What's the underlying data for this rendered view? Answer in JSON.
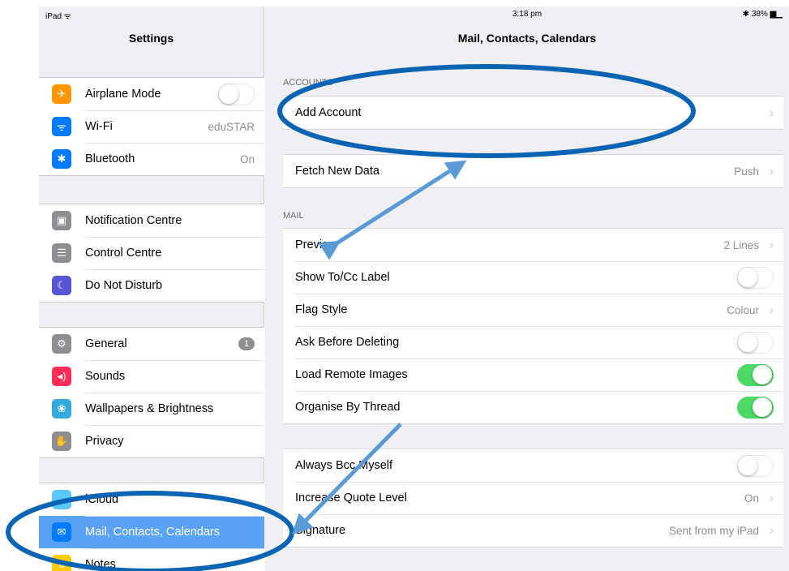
{
  "status": {
    "device": "iPad ᯤ",
    "time": "3:18 pm",
    "battery": "✱ 38% ▆▁"
  },
  "sidebar": {
    "title": "Settings",
    "groups": [
      [
        {
          "label": "Airplane Mode",
          "icon": "airplane-icon",
          "color": "#ff9500",
          "glyph": "✈",
          "toggle": false
        },
        {
          "label": "Wi-Fi",
          "icon": "wifi-icon",
          "color": "#007aff",
          "glyph": "ᯤ",
          "value": "eduSTAR"
        },
        {
          "label": "Bluetooth",
          "icon": "bluetooth-icon",
          "color": "#007aff",
          "glyph": "✱",
          "value": "On"
        }
      ],
      [
        {
          "label": "Notification Centre",
          "icon": "notification-centre-icon",
          "color": "#8e8e93",
          "glyph": "▣"
        },
        {
          "label": "Control Centre",
          "icon": "control-centre-icon",
          "color": "#8e8e93",
          "glyph": "☰"
        },
        {
          "label": "Do Not Disturb",
          "icon": "moon-icon",
          "color": "#5856d6",
          "glyph": "☾"
        }
      ],
      [
        {
          "label": "General",
          "icon": "gear-icon",
          "color": "#8e8e93",
          "glyph": "⚙",
          "badge": "1"
        },
        {
          "label": "Sounds",
          "icon": "speaker-icon",
          "color": "#ff2d55",
          "glyph": "◂)"
        },
        {
          "label": "Wallpapers & Brightness",
          "icon": "wallpaper-icon",
          "color": "#34aadc",
          "glyph": "❀"
        },
        {
          "label": "Privacy",
          "icon": "hand-icon",
          "color": "#8e8e93",
          "glyph": "✋"
        }
      ],
      [
        {
          "label": "iCloud",
          "icon": "cloud-icon",
          "color": "#5ac8fa",
          "glyph": "☁"
        },
        {
          "label": "Mail, Contacts, Calendars",
          "icon": "mail-icon",
          "color": "#007aff",
          "glyph": "✉",
          "selected": true
        },
        {
          "label": "Notes",
          "icon": "notes-icon",
          "color": "#ffcc00",
          "glyph": "≡"
        }
      ]
    ]
  },
  "main": {
    "title": "Mail, Contacts, Calendars",
    "accounts_header": "ACCOUNTS",
    "add_account": "Add Account",
    "fetch_new_data": {
      "label": "Fetch New Data",
      "value": "Push"
    },
    "mail_header": "MAIL",
    "mail_rows": [
      {
        "label": "Preview",
        "value": "2 Lines",
        "type": "chevron"
      },
      {
        "label": "Show To/Cc Label",
        "type": "toggle",
        "on": false
      },
      {
        "label": "Flag Style",
        "value": "Colour",
        "type": "chevron"
      },
      {
        "label": "Ask Before Deleting",
        "type": "toggle",
        "on": false
      },
      {
        "label": "Load Remote Images",
        "type": "toggle",
        "on": true
      },
      {
        "label": "Organise By Thread",
        "type": "toggle",
        "on": true
      }
    ],
    "compose_rows": [
      {
        "label": "Always Bcc Myself",
        "type": "toggle",
        "on": false
      },
      {
        "label": "Increase Quote Level",
        "value": "On",
        "type": "chevron"
      },
      {
        "label": "Signature",
        "value": "Sent from my iPad",
        "type": "chevron"
      }
    ]
  },
  "colors": {
    "annotation_ellipse": "#0a64b4",
    "annotation_arrow": "#5b9bd5",
    "toggle_on": "#4cd964",
    "selected_row": "#5aa2f5"
  }
}
